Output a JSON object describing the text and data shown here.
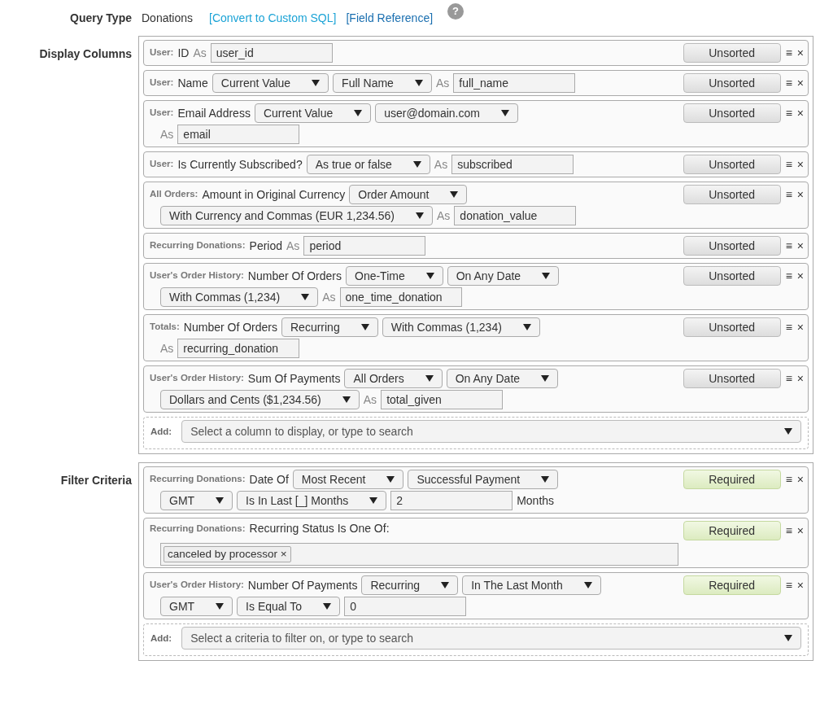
{
  "query": {
    "label": "Query Type",
    "value": "Donations",
    "links": [
      "[Convert to Custom SQL]",
      "[Field Reference]"
    ],
    "help": "?"
  },
  "sections": [
    {
      "title": "Display Columns",
      "rows": [
        {
          "source": "User:",
          "field": "ID",
          "sort": {
            "kind": "unsorted",
            "label": "Unsorted"
          },
          "handle": "≡",
          "remove": "×",
          "lines": [
            [
              {
                "kind": "label",
                "text": "As"
              },
              {
                "kind": "input",
                "value": "user_id"
              }
            ]
          ]
        },
        {
          "source": "User:",
          "field": "Name",
          "sort": {
            "kind": "unsorted",
            "label": "Unsorted"
          },
          "handle": "≡",
          "remove": "×",
          "lines": [
            [
              {
                "kind": "select",
                "value": "Current Value"
              },
              {
                "kind": "select",
                "value": "Full Name"
              },
              {
                "kind": "label",
                "text": "As"
              },
              {
                "kind": "input",
                "value": "full_name"
              }
            ]
          ]
        },
        {
          "source": "User:",
          "field": "Email Address",
          "sort": {
            "kind": "unsorted",
            "label": "Unsorted"
          },
          "handle": "≡",
          "remove": "×",
          "lines": [
            [
              {
                "kind": "select",
                "value": "Current Value"
              },
              {
                "kind": "select",
                "value": "user@domain.com"
              }
            ],
            [
              {
                "kind": "label",
                "text": "As"
              },
              {
                "kind": "input",
                "value": "email"
              }
            ]
          ]
        },
        {
          "source": "User:",
          "field": "Is Currently Subscribed?",
          "sort": {
            "kind": "unsorted",
            "label": "Unsorted"
          },
          "handle": "≡",
          "remove": "×",
          "lines": [
            [
              {
                "kind": "select",
                "value": "As true or false"
              },
              {
                "kind": "label",
                "text": "As"
              },
              {
                "kind": "input",
                "value": "subscribed"
              }
            ]
          ]
        },
        {
          "source": "All Orders:",
          "field": "Amount in Original Currency",
          "sort": {
            "kind": "unsorted",
            "label": "Unsorted"
          },
          "handle": "≡",
          "remove": "×",
          "lines": [
            [
              {
                "kind": "select",
                "value": "Order Amount"
              }
            ],
            [
              {
                "kind": "select",
                "value": "With Currency and Commas (EUR 1,234.56)"
              },
              {
                "kind": "label",
                "text": "As"
              },
              {
                "kind": "input",
                "value": "donation_value"
              }
            ]
          ]
        },
        {
          "source": "Recurring Donations:",
          "field": "Period",
          "sort": {
            "kind": "unsorted",
            "label": "Unsorted"
          },
          "handle": "≡",
          "remove": "×",
          "lines": [
            [
              {
                "kind": "label",
                "text": "As"
              },
              {
                "kind": "input",
                "value": "period"
              }
            ]
          ]
        },
        {
          "source": "User's Order History:",
          "field": "Number Of Orders",
          "sort": {
            "kind": "unsorted",
            "label": "Unsorted"
          },
          "handle": "≡",
          "remove": "×",
          "lines": [
            [
              {
                "kind": "select",
                "value": "One-Time"
              },
              {
                "kind": "select",
                "value": "On Any Date"
              }
            ],
            [
              {
                "kind": "select",
                "value": "With Commas (1,234)"
              },
              {
                "kind": "label",
                "text": "As"
              },
              {
                "kind": "input",
                "value": "one_time_donation"
              }
            ]
          ]
        },
        {
          "source": "Totals:",
          "field": "Number Of Orders",
          "sort": {
            "kind": "unsorted",
            "label": "Unsorted"
          },
          "handle": "≡",
          "remove": "×",
          "lines": [
            [
              {
                "kind": "select",
                "value": "Recurring"
              },
              {
                "kind": "select",
                "value": "With Commas (1,234)"
              }
            ],
            [
              {
                "kind": "label",
                "text": "As"
              },
              {
                "kind": "input",
                "value": "recurring_donation"
              }
            ]
          ]
        },
        {
          "source": "User's Order History:",
          "field": "Sum Of Payments",
          "sort": {
            "kind": "unsorted",
            "label": "Unsorted"
          },
          "handle": "≡",
          "remove": "×",
          "lines": [
            [
              {
                "kind": "select",
                "value": "All Orders"
              },
              {
                "kind": "select",
                "value": "On Any Date"
              }
            ],
            [
              {
                "kind": "select",
                "value": "Dollars and Cents ($1,234.56)"
              },
              {
                "kind": "label",
                "text": "As"
              },
              {
                "kind": "input",
                "value": "total_given"
              }
            ]
          ]
        }
      ],
      "add": {
        "label": "Add:",
        "placeholder": "Select a column to display, or type to search"
      }
    },
    {
      "title": "Filter Criteria",
      "rows": [
        {
          "source": "Recurring Donations:",
          "field": "Date Of",
          "sort": {
            "kind": "required",
            "label": "Required"
          },
          "handle": "≡",
          "remove": "×",
          "lines": [
            [
              {
                "kind": "select",
                "value": "Most Recent"
              },
              {
                "kind": "select",
                "value": "Successful Payment"
              }
            ],
            [
              {
                "kind": "select",
                "value": "GMT"
              },
              {
                "kind": "select",
                "value": "Is In Last [_] Months"
              },
              {
                "kind": "input",
                "value": "2"
              },
              {
                "kind": "text",
                "text": "Months"
              }
            ]
          ]
        },
        {
          "source": "Recurring Donations:",
          "field": "Recurring Status Is One Of:",
          "sort": {
            "kind": "required",
            "label": "Required"
          },
          "handle": "≡",
          "remove": "×",
          "lines": [
            [
              {
                "kind": "tags",
                "tags": [
                  {
                    "label": "canceled by processor",
                    "remove": "×"
                  }
                ]
              }
            ]
          ]
        },
        {
          "source": "User's Order History:",
          "field": "Number Of Payments",
          "sort": {
            "kind": "required",
            "label": "Required"
          },
          "handle": "≡",
          "remove": "×",
          "lines": [
            [
              {
                "kind": "select",
                "value": "Recurring"
              },
              {
                "kind": "select",
                "value": "In The Last Month"
              }
            ],
            [
              {
                "kind": "select",
                "value": "GMT"
              },
              {
                "kind": "select",
                "value": "Is Equal To"
              },
              {
                "kind": "input",
                "value": "0"
              }
            ]
          ]
        }
      ],
      "add": {
        "label": "Add:",
        "placeholder": "Select a criteria to filter on, or type to search"
      }
    }
  ]
}
